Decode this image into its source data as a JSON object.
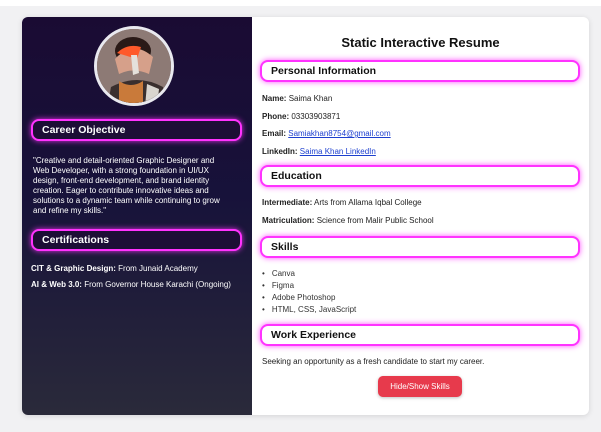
{
  "sidebar": {
    "career_objective_title": "Career Objective",
    "career_objective_lines": [
      "\"Creative and detail-oriented Graphic Designer and",
      "Web Developer, with a strong foundation in UI/UX",
      "design, front-end development, and brand identity",
      "creation. Eager to contribute innovative ideas and",
      "solutions to a dynamic team while continuing to grow",
      "and refine my skills.\""
    ],
    "certifications_title": "Certifications",
    "certifications": [
      {
        "label": "CIT & Graphic Design:",
        "value": "From Junaid Academy"
      },
      {
        "label": "AI & Web 3.0:",
        "value": "From Governor House Karachi (Ongoing)"
      }
    ]
  },
  "main": {
    "title": "Static Interactive Resume",
    "personal": {
      "heading": "Personal Information",
      "name_label": "Name:",
      "name_value": "Saima Khan",
      "phone_label": "Phone:",
      "phone_value": "03303903871",
      "email_label": "Email:",
      "email_value": "Samiakhan8754@gmail.com",
      "linkedin_label": "LinkedIn:",
      "linkedin_value": "Saima Khan LinkedIn"
    },
    "education": {
      "heading": "Education",
      "intermediate_label": "Intermediate:",
      "intermediate_value": "Arts from Allama Iqbal College",
      "matric_label": "Matriculation:",
      "matric_value": "Science from Malir Public School"
    },
    "skills": {
      "heading": "Skills",
      "items": [
        "Canva",
        "Figma",
        "Adobe Photoshop",
        "HTML, CSS, JavaScript"
      ]
    },
    "work": {
      "heading": "Work Experience",
      "text": "Seeking an opportunity as a fresh candidate to start my career."
    },
    "toggle_button_label": "Hide/Show Skills"
  },
  "colors": {
    "accent_glow": "#ff33ff",
    "button": "#e73a4c",
    "link": "#1d3fcf",
    "sidebar_bg": "#1a0b33"
  }
}
